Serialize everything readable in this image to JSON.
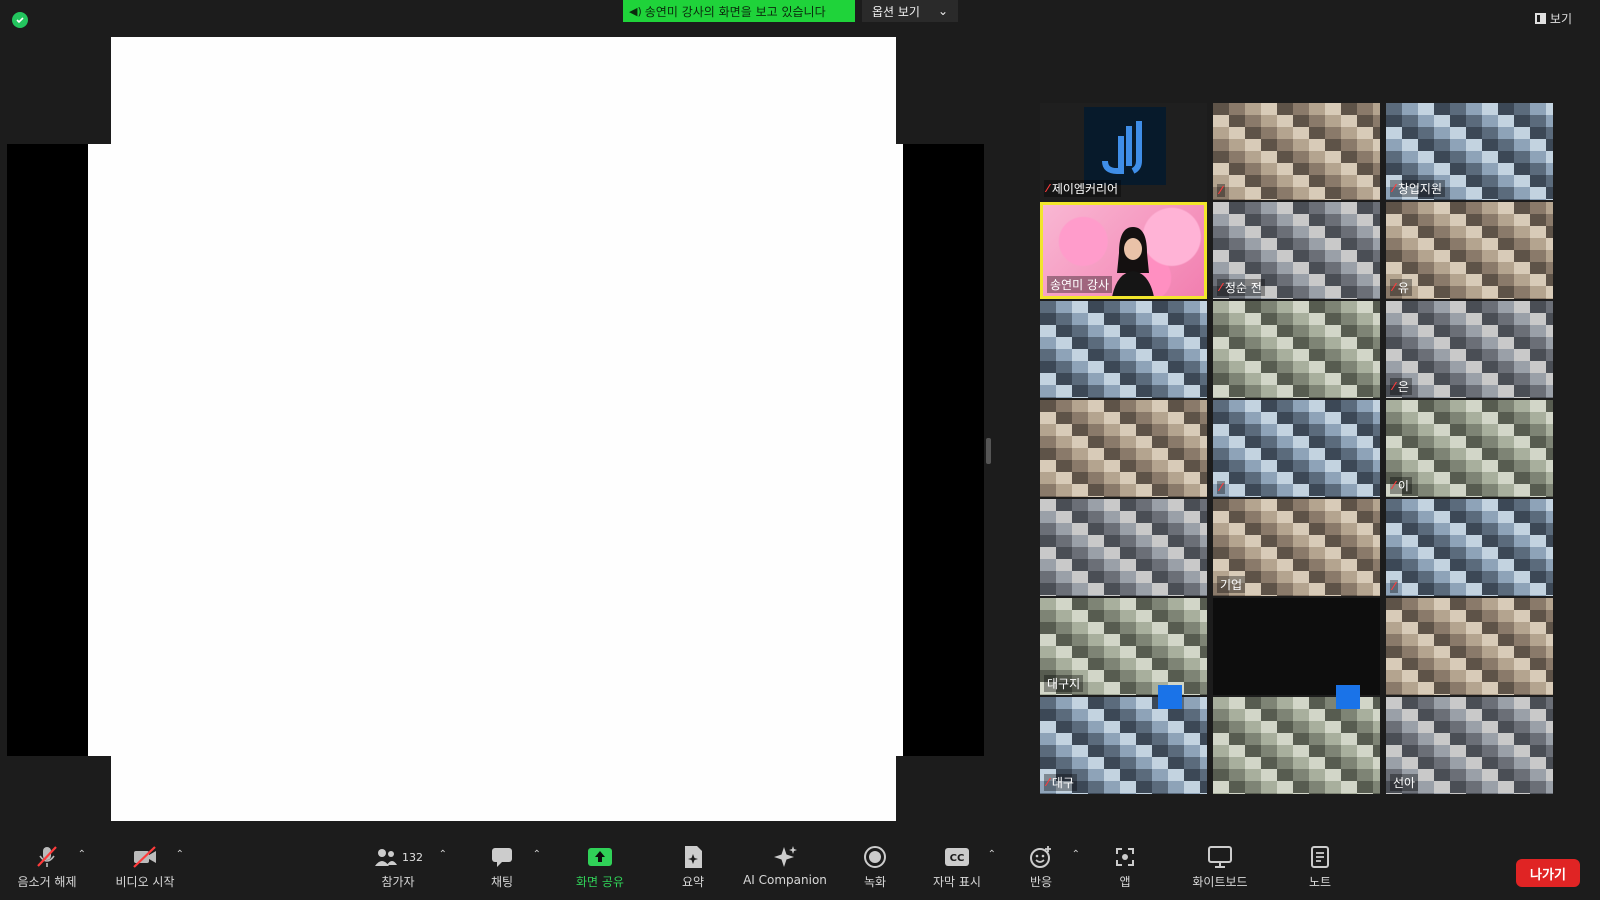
{
  "banner": {
    "text": "송연미 강사의 화면을 보고 있습니다"
  },
  "view_options": {
    "label": "옵션 보기"
  },
  "view_button": {
    "label": "보기"
  },
  "gallery": {
    "tiles": [
      {
        "name": "제이엠커리어",
        "muted": true,
        "kind": "logo"
      },
      {
        "name": "",
        "muted": true,
        "kind": "blur"
      },
      {
        "name": "창업지원",
        "muted": true,
        "kind": "blur"
      },
      {
        "name": "송연미 강사",
        "muted": false,
        "kind": "speaker",
        "active": true
      },
      {
        "name": "정순 전",
        "muted": true,
        "kind": "blur"
      },
      {
        "name": "유",
        "muted": true,
        "kind": "blur"
      },
      {
        "name": "",
        "muted": false,
        "kind": "blur"
      },
      {
        "name": "",
        "muted": false,
        "kind": "blur"
      },
      {
        "name": "은",
        "muted": true,
        "kind": "blur"
      },
      {
        "name": "",
        "muted": false,
        "kind": "blur"
      },
      {
        "name": "",
        "muted": true,
        "kind": "blur"
      },
      {
        "name": "이",
        "muted": true,
        "kind": "blur"
      },
      {
        "name": "",
        "muted": false,
        "kind": "blur"
      },
      {
        "name": "기업",
        "muted": false,
        "kind": "blur"
      },
      {
        "name": "",
        "muted": true,
        "kind": "blur"
      },
      {
        "name": "대구지",
        "muted": false,
        "kind": "blur"
      },
      {
        "name": "",
        "muted": false,
        "kind": "dark"
      },
      {
        "name": "",
        "muted": false,
        "kind": "blur"
      },
      {
        "name": "대구",
        "muted": true,
        "kind": "blur"
      },
      {
        "name": "",
        "muted": false,
        "kind": "blur"
      },
      {
        "name": "선아",
        "muted": false,
        "kind": "blur"
      }
    ]
  },
  "toolbar": {
    "unmute": "음소거 해제",
    "start_video": "비디오 시작",
    "participants": "참가자",
    "participants_count": "132",
    "chat": "채팅",
    "share_screen": "화면 공유",
    "summary": "요약",
    "ai_companion": "AI Companion",
    "record": "녹화",
    "captions": "자막 표시",
    "reactions": "반응",
    "apps": "앱",
    "whiteboard": "화이트보드",
    "notes": "노트",
    "leave": "나가기"
  },
  "colors": {
    "banner_green": "#1fd33a",
    "share_green": "#30d158",
    "leave_red": "#e02424",
    "active_speaker": "#f2e62c",
    "mute_red": "#ff3b3b"
  }
}
